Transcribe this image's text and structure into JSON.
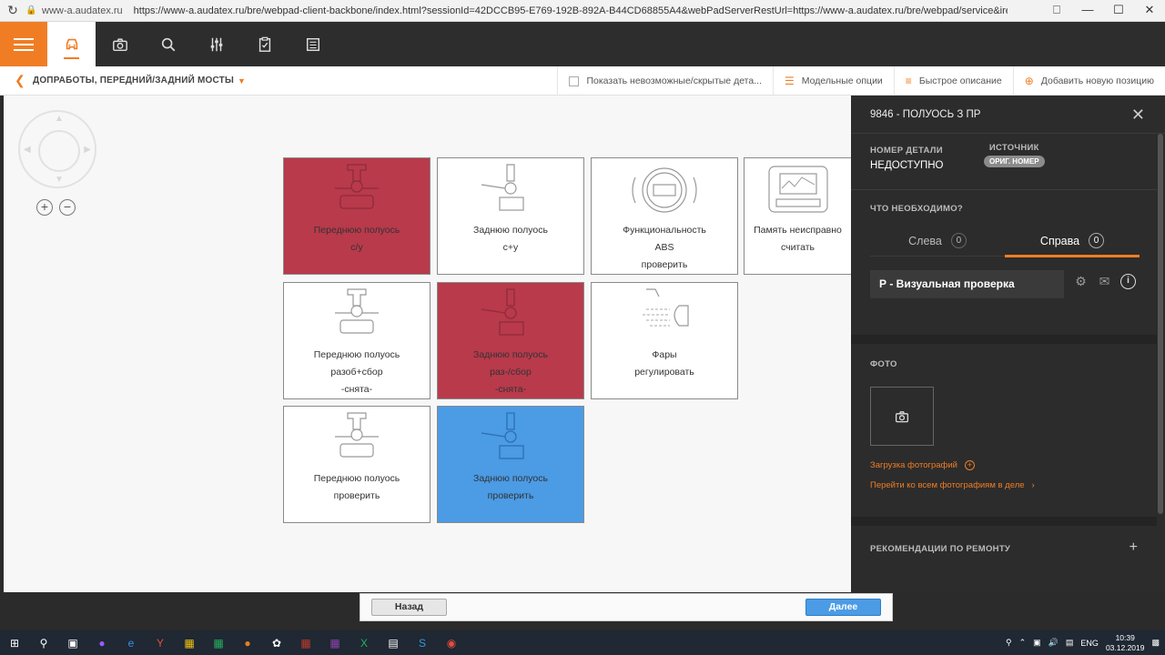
{
  "browser": {
    "domain": "www-a.audatex.ru",
    "url": "https://www-a.audatex.ru/bre/webpad-client-backbone/index.html?sessionId=42DCCB95-E769-192B-892A-B44CD68855A4&webPadServerRestUrl=https://www-a.audatex.ru/bre/webpad/service&ireWebClientUrl=h..."
  },
  "breadcrumb": {
    "title": "ДОПРАБОТЫ, ПЕРЕДНИЙ/ЗАДНИЙ МОСТЫ",
    "show_hidden": "Показать невозможные/скрытые дета...",
    "model_options": "Модельные опции",
    "quick_desc": "Быстрое описание",
    "add_position": "Добавить новую позицию"
  },
  "tiles": [
    {
      "line1": "Переднюю полуось",
      "line2": "с/у",
      "line3": "",
      "state": "red"
    },
    {
      "line1": "Заднюю полуось",
      "line2": "с+у",
      "line3": "",
      "state": "normal"
    },
    {
      "line1": "Функциональность",
      "line2": "ABS",
      "line3": "проверить",
      "state": "normal"
    },
    {
      "line1": "Память неисправно",
      "line2": "считать",
      "line3": "",
      "state": "normal"
    },
    {
      "line1": "Переднюю полуось",
      "line2": "разоб+сбор",
      "line3": "-снята-",
      "state": "normal"
    },
    {
      "line1": "Заднюю полуось",
      "line2": "раз-/сбор",
      "line3": "-снята-",
      "state": "red"
    },
    {
      "line1": "Фары",
      "line2": "регулировать",
      "line3": "",
      "state": "normal"
    },
    {
      "line1": "Переднюю полуось",
      "line2": "проверить",
      "line3": "",
      "state": "normal"
    },
    {
      "line1": "Заднюю полуось",
      "line2": "проверить",
      "line3": "",
      "state": "blue"
    }
  ],
  "panel": {
    "header": "9846 - ПОЛУОСЬ З ПР",
    "part_label": "НОМЕР ДЕТАЛИ",
    "part_value": "НЕДОСТУПНО",
    "source_label": "ИСТОЧНИК",
    "source_badge": "ОРИГ. НОМЕР",
    "need_label": "ЧТО НЕОБХОДИМО?",
    "left_label": "Слева",
    "left_count": "0",
    "right_label": "Справа",
    "right_count": "0",
    "operation": "Р - Визуальная проверка",
    "photo_label": "ФОТО",
    "upload_photo": "Загрузка фотографий",
    "all_photos": "Перейти ко всем фотографиям в деле",
    "recommendations": "РЕКОМЕНДАЦИИ ПО РЕМОНТУ"
  },
  "footer": {
    "back": "Назад",
    "next": "Далее"
  },
  "taskbar": {
    "lang": "ENG",
    "time": "10:39",
    "date": "03.12.2019"
  },
  "colors": {
    "accent": "#f07d24",
    "tile_red": "#b83a4b",
    "tile_blue": "#4b9be5",
    "panel_bg": "#2c2c2c"
  }
}
